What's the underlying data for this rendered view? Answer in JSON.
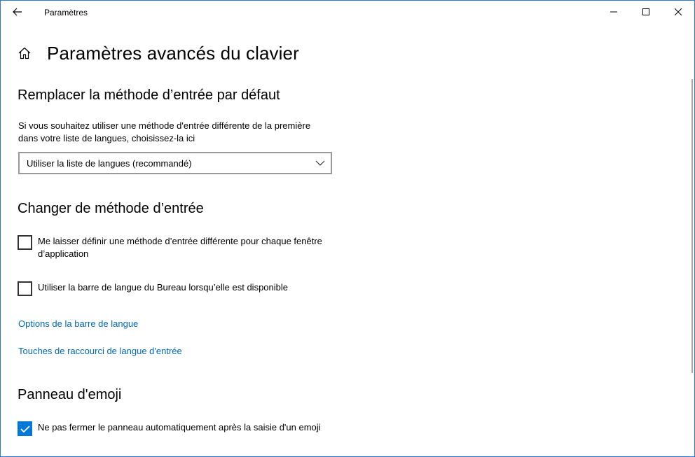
{
  "window": {
    "app_title": "Paramètres",
    "controls": {
      "back": "back-arrow-icon",
      "minimize": "minimize-icon",
      "maximize": "maximize-icon",
      "close": "close-icon"
    }
  },
  "header": {
    "title": "Paramètres avancés du clavier",
    "icon": "home-icon"
  },
  "override_section": {
    "title": "Remplacer la méthode d’entrée par défaut",
    "description": "Si vous souhaitez utiliser une méthode d'entrée différente de la première dans votre liste de langues, choisissez-la ici",
    "dropdown_value": "Utiliser la liste de langues (recommandé)"
  },
  "switch_section": {
    "title": "Changer de méthode d’entrée",
    "checkbox_per_app": {
      "label": "Me laisser définir une méthode d’entrée différente pour chaque fenêtre d’application",
      "checked": false
    },
    "checkbox_language_bar": {
      "label": "Utiliser la barre de langue du Bureau lorsqu’elle est disponible",
      "checked": false
    },
    "link_language_bar_options": "Options de la barre de langue",
    "link_hotkeys": "Touches de raccourci de langue d'entrée"
  },
  "emoji_section": {
    "title": "Panneau d'emoji",
    "checkbox_keep_open": {
      "label": "Ne pas fermer le panneau automatiquement après la saisie d'un emoji",
      "checked": true
    }
  },
  "colors": {
    "accent": "#0078d7",
    "link": "#0067b8",
    "window_border": "#2b79d0"
  }
}
